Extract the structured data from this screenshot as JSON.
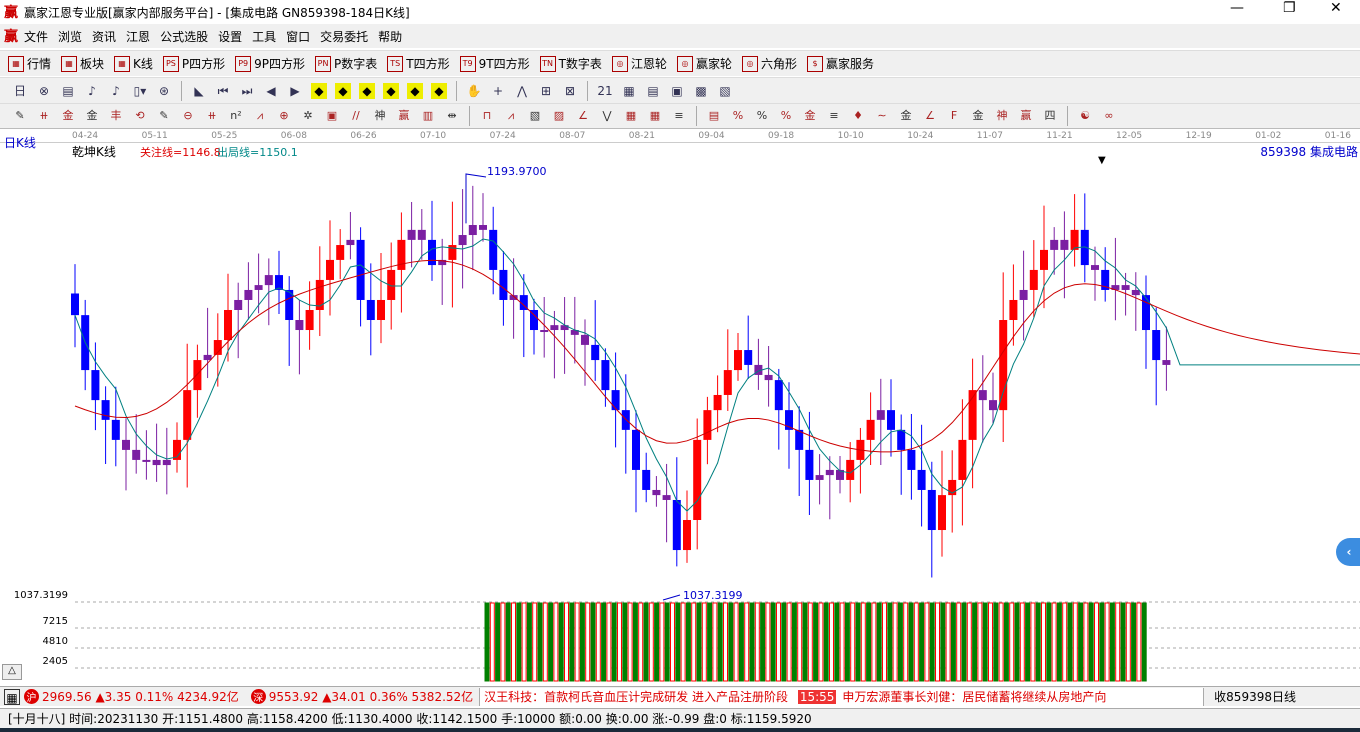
{
  "window": {
    "title": "赢家江恩专业版[赢家内部服务平台] - [集成电路  GN859398-184日K线]",
    "logo": "赢",
    "min": "—",
    "max": "❐",
    "close": "✕"
  },
  "menu": [
    "文件",
    "浏览",
    "资讯",
    "江恩",
    "公式选股",
    "设置",
    "工具",
    "窗口",
    "交易委托",
    "帮助"
  ],
  "toolbar1": [
    {
      "icon": "grid",
      "label": "行情"
    },
    {
      "icon": "blocks",
      "label": "板块"
    },
    {
      "icon": "kline",
      "label": "K线"
    },
    {
      "icon": "PS",
      "label": "P四方形"
    },
    {
      "icon": "P9",
      "label": "9P四方形"
    },
    {
      "icon": "PN",
      "label": "P数字表"
    },
    {
      "icon": "TS",
      "label": "T四方形"
    },
    {
      "icon": "T9",
      "label": "9T四方形"
    },
    {
      "icon": "TN",
      "label": "T数字表"
    },
    {
      "icon": "◎",
      "label": "江恩轮"
    },
    {
      "icon": "◎",
      "label": "赢家轮"
    },
    {
      "icon": "◎",
      "label": "六角形"
    },
    {
      "icon": "$",
      "label": "赢家服务"
    }
  ],
  "toolbar2": [
    "日▾",
    "⊗",
    "▤",
    "♪",
    "♪",
    "▯▾",
    "⊛",
    "◣",
    "⏮",
    "⏭",
    "◀",
    "▶",
    "◆",
    "◆",
    "◆",
    "◆",
    "◆",
    "◆",
    "✋",
    "+",
    "⋀",
    "⊞",
    "⊠",
    "21",
    "▦",
    "▤",
    "▣",
    "▩",
    "▧"
  ],
  "toolbar3": [
    "✎",
    "⧺",
    "金",
    "金",
    "丰",
    "⟲",
    "✎",
    "⊖",
    "⧺",
    "n²",
    "⩘",
    "⊕",
    "✲",
    "▣",
    "//",
    "神",
    "赢",
    "▥",
    "⇹",
    "⊓",
    "⩘",
    "▧",
    "▨",
    "∠",
    "⋁",
    "▦",
    "▦",
    "≡",
    "▤",
    "%",
    "%",
    "%",
    "金",
    "≡",
    "♦",
    "∼",
    "金",
    "∠",
    "F",
    "金",
    "神",
    "赢",
    "四",
    "☯",
    "∞"
  ],
  "dates": [
    "04-24",
    "05-11",
    "05-25",
    "06-08",
    "06-26",
    "07-10",
    "07-24",
    "08-07",
    "08-21",
    "09-04",
    "09-18",
    "10-10",
    "10-24",
    "11-07",
    "11-21",
    "12-05",
    "12-19",
    "01-02",
    "01-16"
  ],
  "chart_header": {
    "period": "日K线",
    "indicator": "乾坤K线",
    "focus_line": "关注线=1146.8",
    "exit_line": "出局线=1150.1",
    "code_name": "859398  集成电路",
    "high_label": "1193.9700",
    "low_label": "1037.3199"
  },
  "volume_axis": [
    "1037.3199",
    "7215",
    "4810",
    "2405"
  ],
  "colors": {
    "up": "#ff0000",
    "down": "#0000ff",
    "flat": "#7b1fa2",
    "ma_fast": "#008080",
    "ma_slow": "#cc0000",
    "vol_green": "#008000",
    "vol_red": "#ff0000"
  },
  "chart_data": {
    "type": "candlestick",
    "ylim": [
      1030,
      1200
    ],
    "closes": [
      1141.1,
      1120.8,
      1109.7,
      1102.4,
      1095.0,
      1091.3,
      1087.6,
      1087.6,
      1085.7,
      1087.6,
      1095.0,
      1113.4,
      1124.5,
      1126.4,
      1131.9,
      1143.0,
      1146.7,
      1150.4,
      1152.2,
      1155.9,
      1150.4,
      1139.3,
      1135.6,
      1143.0,
      1154.1,
      1161.5,
      1167.0,
      1168.9,
      1146.7,
      1139.3,
      1146.7,
      1157.8,
      1168.9,
      1172.6,
      1168.9,
      1159.6,
      1161.5,
      1167.0,
      1170.7,
      1174.4,
      1172.6,
      1157.8,
      1146.7,
      1148.5,
      1143.0,
      1135.6,
      1135.6,
      1137.4,
      1135.6,
      1133.8,
      1130.1,
      1124.5,
      1113.4,
      1106.0,
      1098.7,
      1083.9,
      1076.5,
      1074.6,
      1072.8,
      1054.3,
      1065.4,
      1095.0,
      1106.0,
      1111.6,
      1120.8,
      1128.2,
      1122.7,
      1119.0,
      1117.1,
      1106.0,
      1098.7,
      1091.3,
      1080.2,
      1082.0,
      1083.9,
      1080.2,
      1087.6,
      1095.0,
      1102.4,
      1106.0,
      1098.7,
      1091.3,
      1083.9,
      1076.5,
      1061.7,
      1074.6,
      1080.2,
      1095.0,
      1113.4,
      1109.7,
      1106.0,
      1139.3,
      1146.7,
      1150.4,
      1157.8,
      1165.2,
      1168.9,
      1165.2,
      1172.6,
      1159.6,
      1157.8,
      1150.4,
      1152.2,
      1150.4,
      1148.5,
      1135.6,
      1124.5,
      1122.7
    ],
    "high": 1193.97,
    "low": 1037.3199
  },
  "status": {
    "sh_icon": "沪",
    "sh": "2969.56 ▲3.35 0.11% 4234.92亿",
    "sz_icon": "深",
    "sz": "9553.92 ▲34.01 0.36% 5382.52亿",
    "news1": "汉王科技：首款柯氏音血压计完成研发 进入产品注册阶段",
    "time": "15:55",
    "news2": "申万宏源董事长刘健：居民储蓄将继续从房地产向",
    "right": "收859398日线"
  },
  "bottom": "[十月十八] 时间:20231130 开:1151.4800 高:1158.4200 低:1130.4000 收:1142.1500 手:10000 额:0.00 换:0.00 涨:-0.99 盘:0 标:1159.5920"
}
